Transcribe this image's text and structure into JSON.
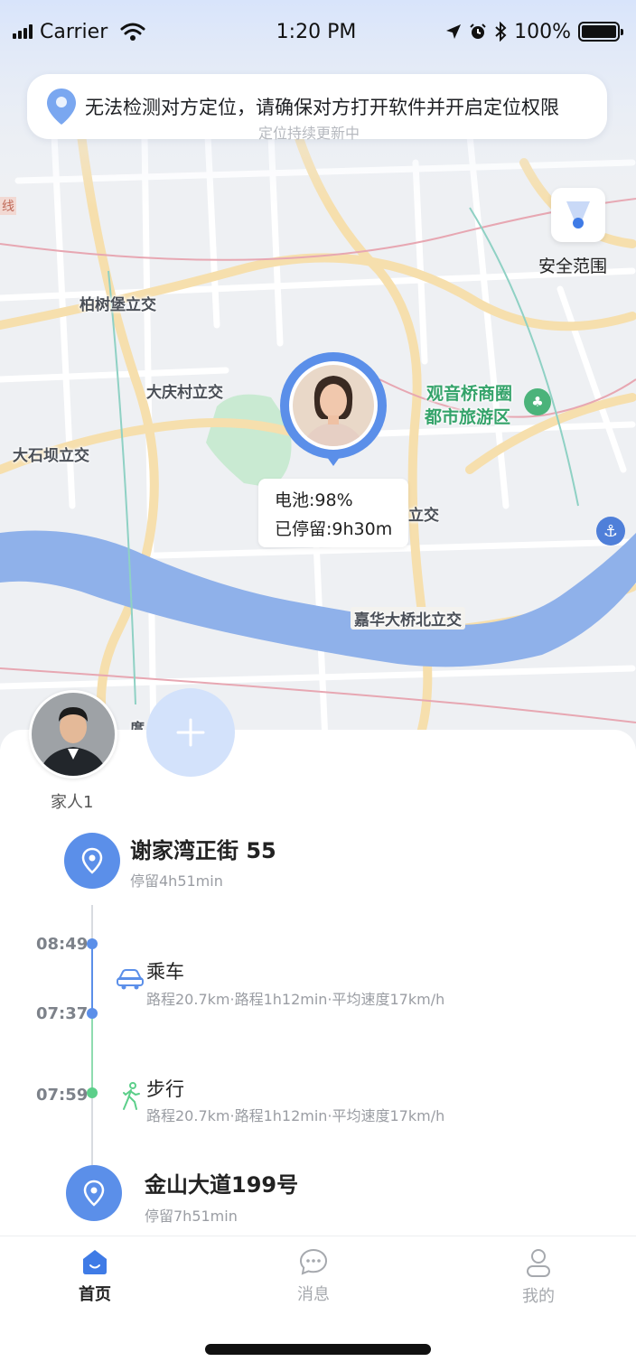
{
  "status_bar": {
    "carrier": "Carrier",
    "time": "1:20 PM",
    "battery": "100%"
  },
  "banner": {
    "text": "无法检测对方定位，请确保对方打开软件并开启定位权限",
    "sub_text": "定位持续更新中"
  },
  "map": {
    "labels": {
      "bai_shu_bao": "柏树堡立交",
      "da_qing_cun": "大庆村立交",
      "da_shi_ba": "大石坝立交",
      "guan_yin_qiao_1": "观音桥商圈",
      "guan_yin_qiao_2": "都市旅游区",
      "jia_hua": "嘉华大桥北立交",
      "partial_jiao": "立交",
      "partial_xian": "线",
      "partial_tang": "庹"
    },
    "safe_range_label": "安全范围",
    "person_info": {
      "battery": "电池:98%",
      "stay": "已停留:9h30m"
    }
  },
  "members": {
    "member1_name": "家人1",
    "add_icon": "plus-icon"
  },
  "timeline": {
    "place_top": {
      "name": "谢家湾正街 55",
      "stay": "停留4h51min"
    },
    "segments": [
      {
        "start_time": "08:49",
        "end_time": "07:37",
        "mode": "乘车",
        "detail": "路程20.7km·路程1h12min·平均速度17km/h",
        "icon": "car-icon"
      },
      {
        "start_time": "07:59",
        "mode": "步行",
        "detail": "路程20.7km·路程1h12min·平均速度17km/h",
        "icon": "walk-icon"
      }
    ],
    "place_bottom": {
      "name": "金山大道199号",
      "stay": "停留7h51min"
    }
  },
  "tabs": [
    {
      "label": "首页",
      "icon": "home-icon",
      "active": true
    },
    {
      "label": "消息",
      "icon": "chat-icon",
      "active": false
    },
    {
      "label": "我的",
      "icon": "user-icon",
      "active": false
    }
  ],
  "colors": {
    "accent": "#5b8fe9",
    "walk_green": "#5ccf8a",
    "river": "#7fa7e6",
    "road": "#f8e2b0"
  }
}
